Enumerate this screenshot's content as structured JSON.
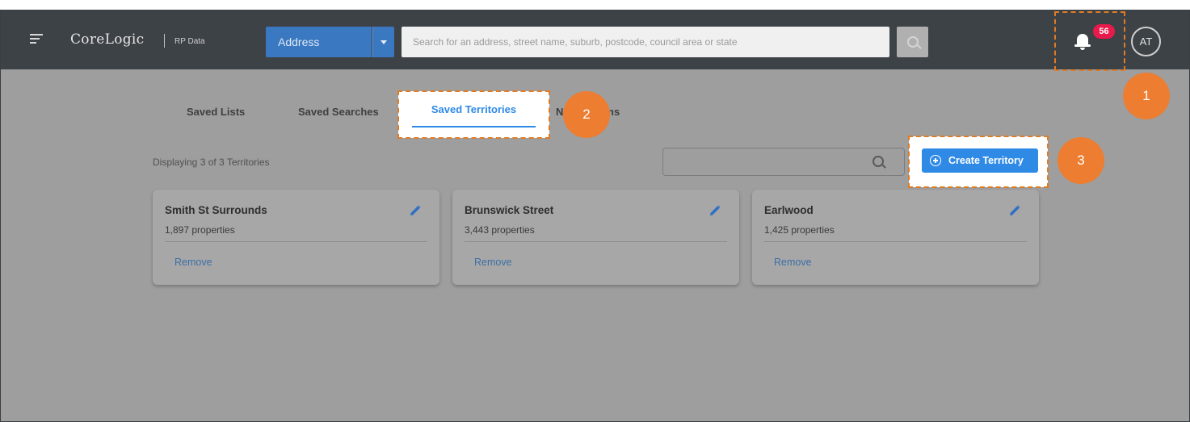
{
  "header": {
    "logo": "CoreLogic",
    "logo_sub": "RP Data",
    "search_type": "Address",
    "search_placeholder": "Search for an address, street name, suburb, postcode, council area or state",
    "notifications_count": "56",
    "avatar_initials": "AT"
  },
  "tabs": {
    "saved_lists": "Saved Lists",
    "saved_searches": "Saved Searches",
    "saved_territories": "Saved Territories",
    "partially_hidden": "N",
    "partially_hidden_tail": "ns"
  },
  "toolbar": {
    "count_text": "Displaying 3 of 3 Territories",
    "create_label": "Create Territory"
  },
  "cards": [
    {
      "title": "Smith St Surrounds",
      "properties": "1,897 properties",
      "remove": "Remove"
    },
    {
      "title": "Brunswick Street",
      "properties": "3,443 properties",
      "remove": "Remove"
    },
    {
      "title": "Earlwood",
      "properties": "1,425 properties",
      "remove": "Remove"
    }
  ],
  "callouts": [
    "1",
    "2",
    "3"
  ],
  "colors": {
    "accent": "#2f8ae6",
    "callout": "#ed7d31",
    "badge": "#e8194b",
    "topbar": "#3d4247"
  }
}
